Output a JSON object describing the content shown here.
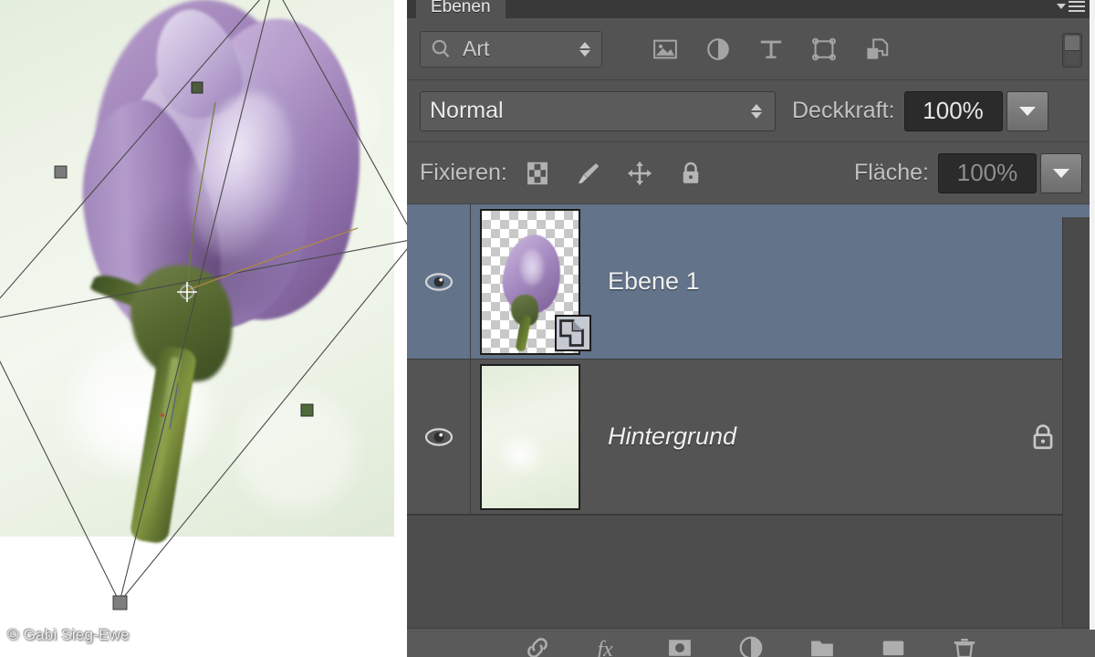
{
  "app": {
    "panel_tab": "Ebenen",
    "panel_menu_icon": "panel-menu-icon"
  },
  "canvas": {
    "watermark": "© Gabi Sieg-Ewe",
    "image_description": "purple rose bud on soft green background",
    "transform_active": true,
    "handles": 8
  },
  "filter_row": {
    "select_value": "Art",
    "search_icon": "search-icon",
    "icons": [
      {
        "name": "filter-pixel-layers-icon",
        "title": "Pixelebenen"
      },
      {
        "name": "filter-adjustment-layers-icon",
        "title": "Einstellungsebenen"
      },
      {
        "name": "filter-type-layers-icon",
        "title": "Textebenen"
      },
      {
        "name": "filter-shape-layers-icon",
        "title": "Formebenen"
      },
      {
        "name": "filter-smart-objects-icon",
        "title": "Smartobjekte"
      }
    ],
    "toggle_name": "filter-enable-toggle"
  },
  "blend_row": {
    "mode": "Normal",
    "opacity_label": "Deckkraft:",
    "opacity_value": "100%"
  },
  "lock_row": {
    "label": "Fixieren:",
    "icons": [
      {
        "name": "lock-transparency-icon"
      },
      {
        "name": "lock-image-pixels-icon"
      },
      {
        "name": "lock-position-icon"
      },
      {
        "name": "lock-all-icon"
      }
    ],
    "fill_label": "Fläche:",
    "fill_value": "100%"
  },
  "layers": [
    {
      "name": "Ebene 1",
      "visible": true,
      "selected": true,
      "italic": false,
      "locked": false,
      "thumb": "transparent-with-rose",
      "badge": "smart-object-badge"
    },
    {
      "name": "Hintergrund",
      "visible": true,
      "selected": false,
      "italic": true,
      "locked": true,
      "thumb": "green-background",
      "badge": null
    }
  ],
  "bottom_bar": {
    "icons": [
      {
        "name": "link-layers-icon"
      },
      {
        "name": "layer-style-fx-icon"
      },
      {
        "name": "add-layer-mask-icon"
      },
      {
        "name": "new-adjustment-layer-icon"
      },
      {
        "name": "new-group-icon"
      },
      {
        "name": "new-layer-icon"
      },
      {
        "name": "delete-layer-icon"
      }
    ]
  },
  "colors": {
    "panel_bg": "#535353",
    "selected_layer": "#62738a",
    "text": "#eaeaea"
  }
}
